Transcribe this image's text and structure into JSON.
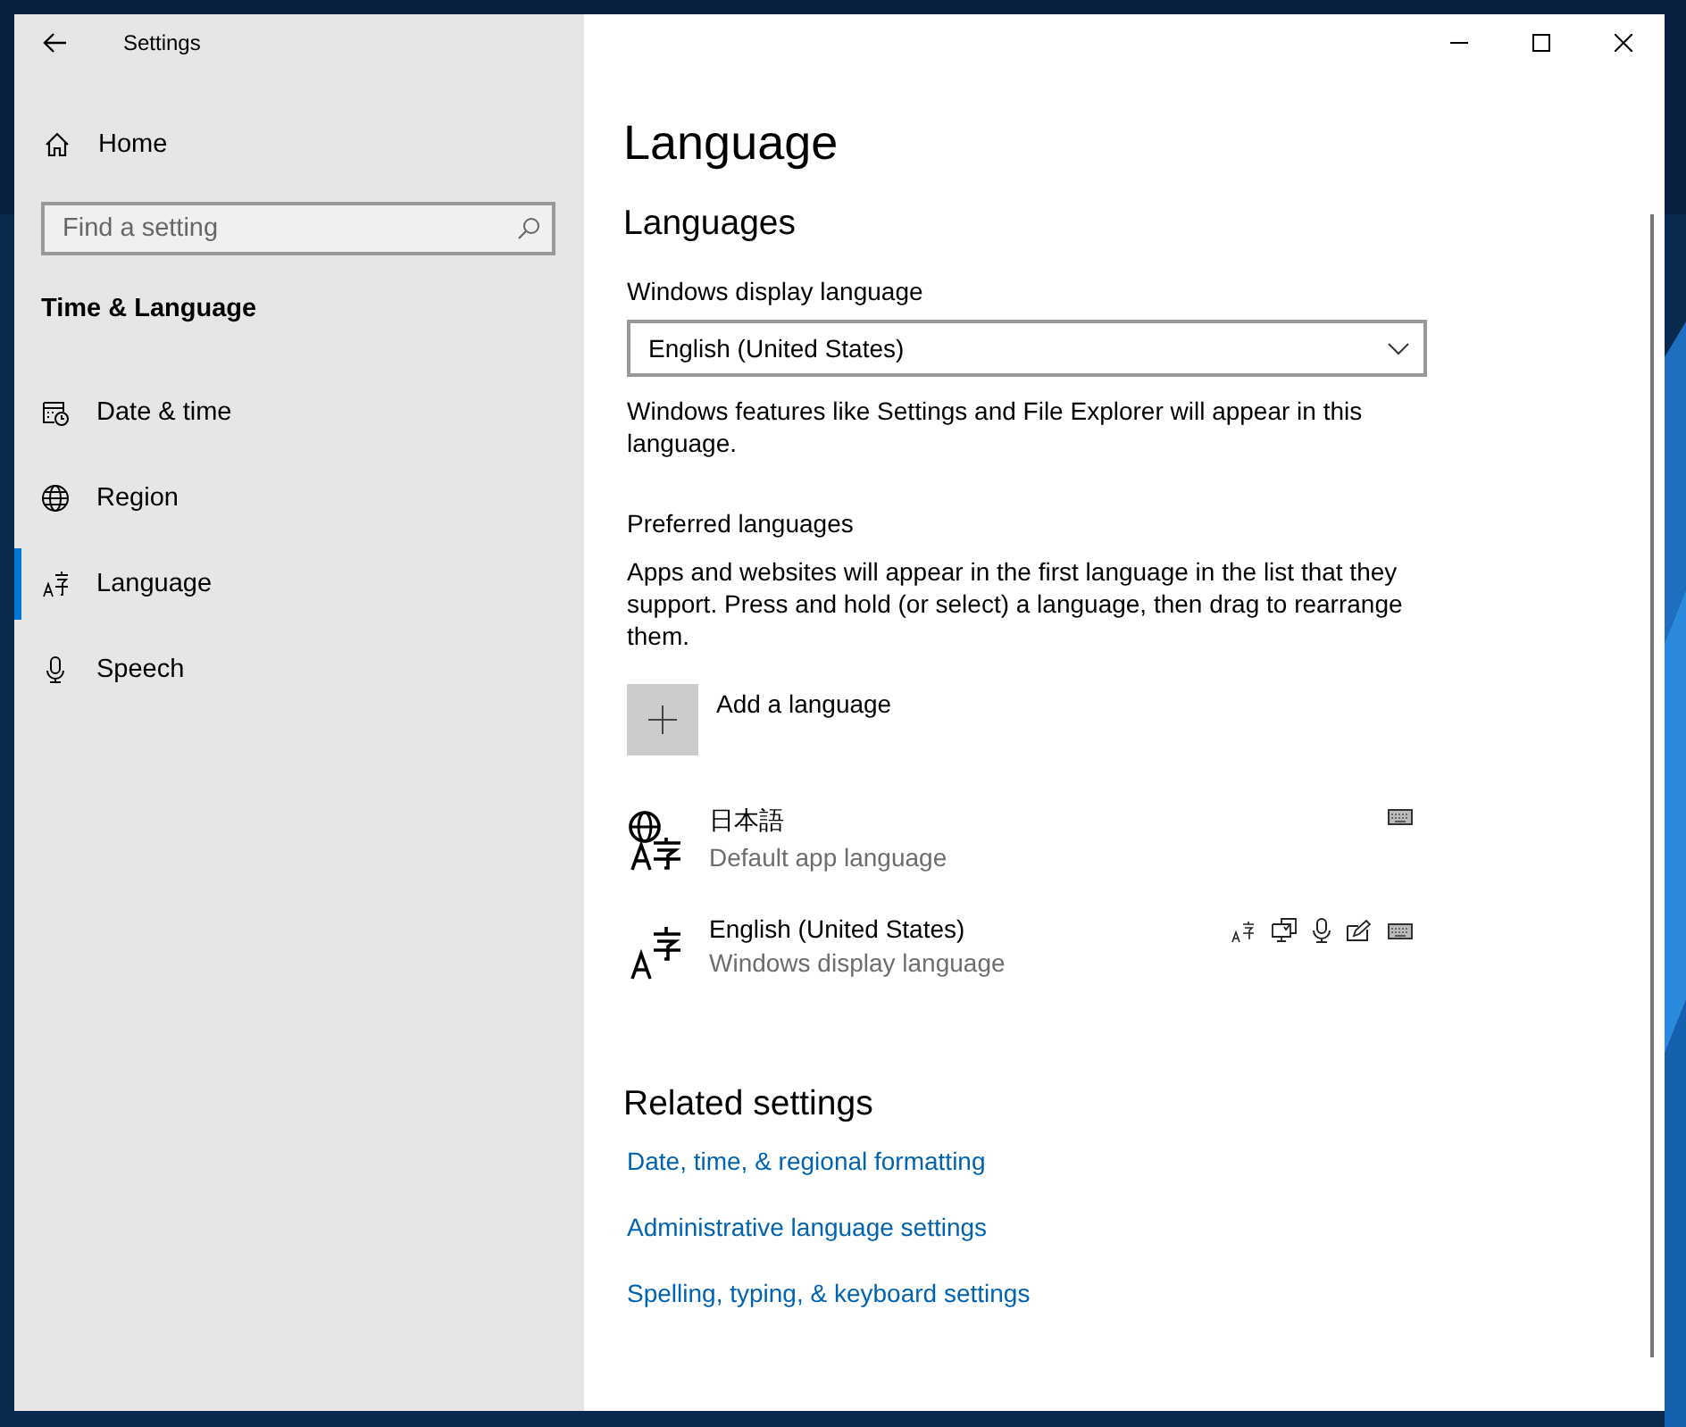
{
  "window": {
    "title": "Settings"
  },
  "sidebar": {
    "home": "Home",
    "search": {
      "placeholder": "Find a setting"
    },
    "section": "Time & Language",
    "items": [
      {
        "label": "Date & time",
        "kind": "date",
        "selected": false
      },
      {
        "label": "Region",
        "kind": "region",
        "selected": false
      },
      {
        "label": "Language",
        "kind": "language",
        "selected": true
      },
      {
        "label": "Speech",
        "kind": "speech",
        "selected": false
      }
    ]
  },
  "content": {
    "title": "Language",
    "subtitle": "Languages",
    "display_language": {
      "label": "Windows display language",
      "value": "English (United States)"
    },
    "display_note": "Windows features like Settings and File Explorer will appear in this language.",
    "preferred_heading": "Preferred languages",
    "preferred_note": "Apps and websites will appear in the first language in the list that they support. Press and hold (or select) a language, then drag to rearrange them.",
    "add_language": "Add a language",
    "languages": [
      {
        "name": "日本語",
        "detail": "Default app language",
        "kind": "default-app"
      },
      {
        "name": "English (United States)",
        "detail": "Windows display language",
        "kind": "display"
      }
    ],
    "related_heading": "Related settings",
    "links": [
      "Date, time, & regional formatting",
      "Administrative language settings",
      "Spelling, typing, & keyboard settings"
    ]
  }
}
